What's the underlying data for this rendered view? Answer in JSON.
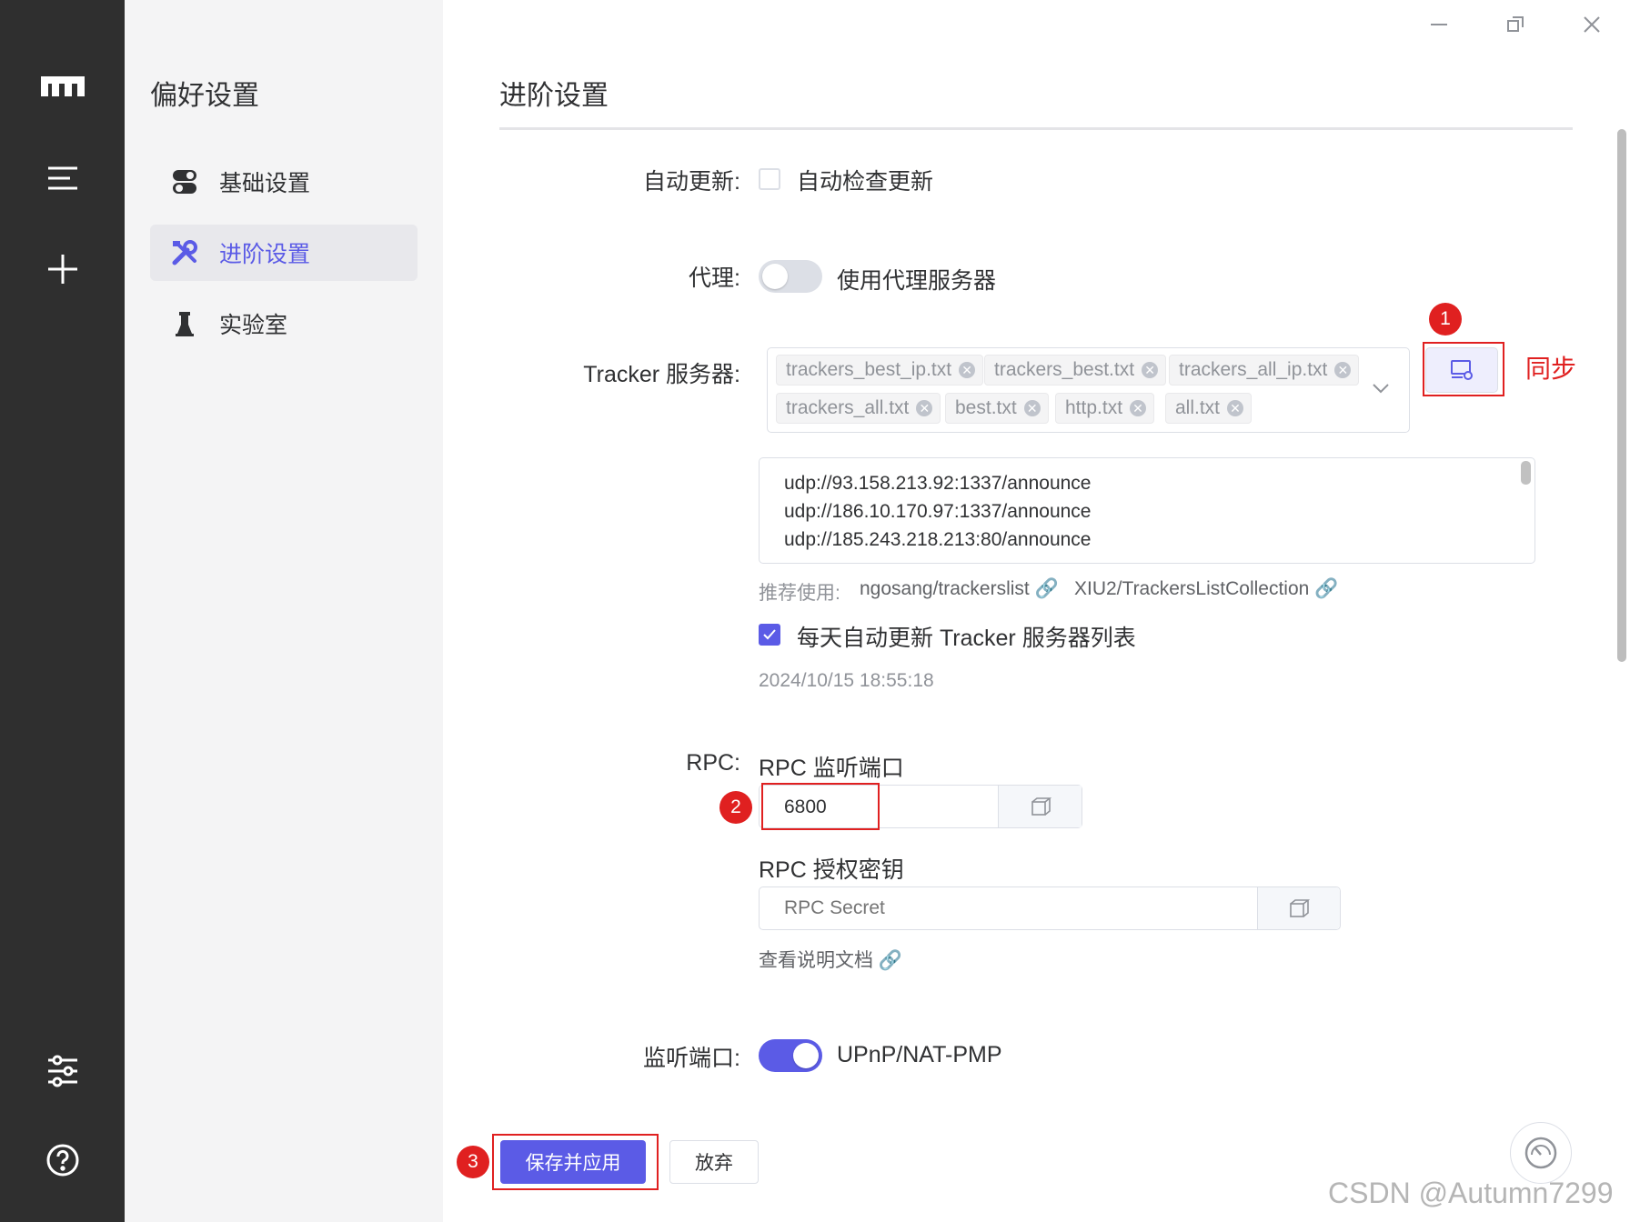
{
  "sidebar": {
    "title": "偏好设置",
    "items": [
      {
        "label": "基础设置",
        "icon": "toggles-icon"
      },
      {
        "label": "进阶设置",
        "icon": "tools-icon",
        "active": true
      },
      {
        "label": "实验室",
        "icon": "flask-icon"
      }
    ]
  },
  "main": {
    "title": "进阶设置",
    "auto_update": {
      "label": "自动更新:",
      "checkbox_label": "自动检查更新",
      "checked": false
    },
    "proxy": {
      "label": "代理:",
      "toggle_label": "使用代理服务器",
      "on": false
    },
    "tracker": {
      "label": "Tracker 服务器:",
      "tags": [
        "trackers_best_ip.txt",
        "trackers_best.txt",
        "trackers_all_ip.txt",
        "trackers_all.txt",
        "best.txt",
        "http.txt",
        "all.txt"
      ],
      "list": [
        "udp://93.158.213.92:1337/announce",
        "udp://186.10.170.97:1337/announce",
        "udp://185.243.218.213:80/announce"
      ],
      "recommend_label": "推荐使用:",
      "recommend_links": [
        "ngosang/trackerslist",
        "XIU2/TrackersListCollection"
      ],
      "auto_update_label": "每天自动更新 Tracker 服务器列表",
      "auto_update_checked": true,
      "last_update": "2024/10/15 18:55:18"
    },
    "rpc": {
      "label": "RPC:",
      "port_label": "RPC 监听端口",
      "port_value": "6800",
      "secret_label": "RPC 授权密钥",
      "secret_placeholder": "RPC Secret",
      "doc_link": "查看说明文档"
    },
    "listen_port": {
      "label": "监听端口:",
      "toggle_label": "UPnP/NAT-PMP",
      "on": true
    }
  },
  "footer": {
    "save_label": "保存并应用",
    "discard_label": "放弃"
  },
  "annotations": {
    "sync_label": "同步",
    "badges": [
      "1",
      "2",
      "3"
    ]
  },
  "watermark": "CSDN @Autumn7299",
  "colors": {
    "accent": "#5b5be6",
    "rail": "#2f2f2f",
    "sidebar": "#f4f4f5",
    "annotation": "#e02020"
  }
}
